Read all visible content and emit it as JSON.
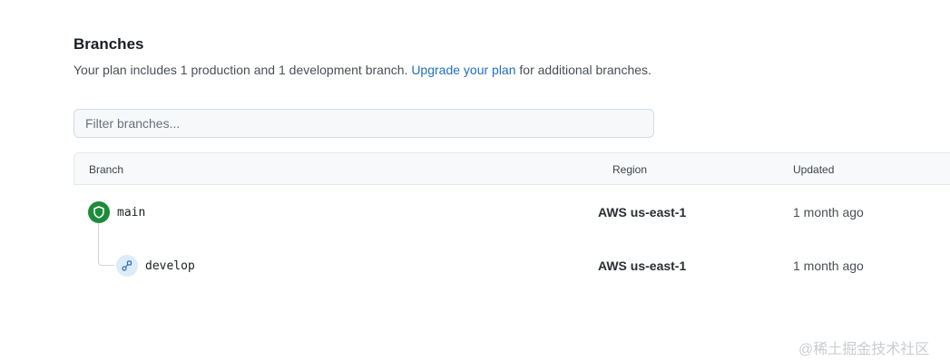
{
  "header": {
    "title": "Branches",
    "subtitle_before": "Your plan includes 1 production and 1 development branch.",
    "upgrade_link": "Upgrade your plan",
    "subtitle_after": "for additional branches."
  },
  "filter": {
    "placeholder": "Filter branches...",
    "value": ""
  },
  "table": {
    "columns": {
      "branch": "Branch",
      "region": "Region",
      "updated": "Updated"
    },
    "rows": [
      {
        "name": "main",
        "region": "AWS us-east-1",
        "updated": "1 month ago",
        "icon": "shield-icon",
        "color": "#1d8b3a"
      },
      {
        "name": "develop",
        "region": "AWS us-east-1",
        "updated": "1 month ago",
        "icon": "branch-icon",
        "color": "#dcecfb"
      }
    ]
  },
  "watermark": "@稀土掘金技术社区"
}
